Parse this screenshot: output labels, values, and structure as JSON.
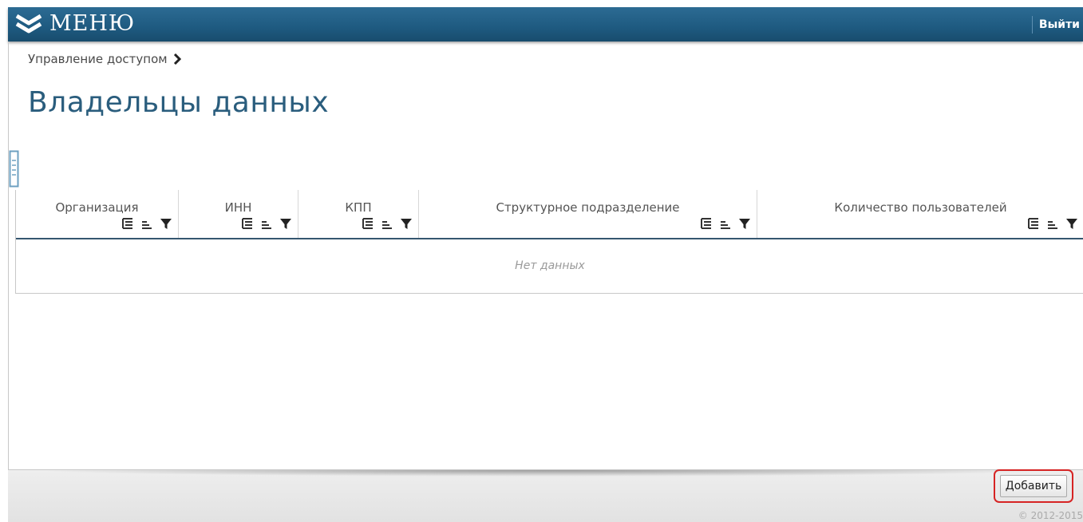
{
  "header": {
    "menu_label": "МЕНЮ",
    "menu_icon": "double-chevron-down-icon",
    "logout_label": "Выйти",
    "bg_color": "#1e5a80"
  },
  "breadcrumb": {
    "label": "Управление доступом",
    "separator_icon": "chevron-right-icon"
  },
  "page": {
    "title": "Владельцы данных",
    "columns_tool_icon": "column-chooser-icon"
  },
  "grid": {
    "columns": [
      {
        "label": "Организация"
      },
      {
        "label": "ИНН"
      },
      {
        "label": "КПП"
      },
      {
        "label": "Структурное подразделение"
      },
      {
        "label": "Количество пользователей"
      }
    ],
    "column_tool_icons": [
      "grouping-icon",
      "sort-icon",
      "filter-icon"
    ],
    "empty_text": "Нет данных"
  },
  "footer": {
    "add_label": "Добавить",
    "copyright": "© 2012-2015",
    "highlight_color": "#d62424"
  }
}
